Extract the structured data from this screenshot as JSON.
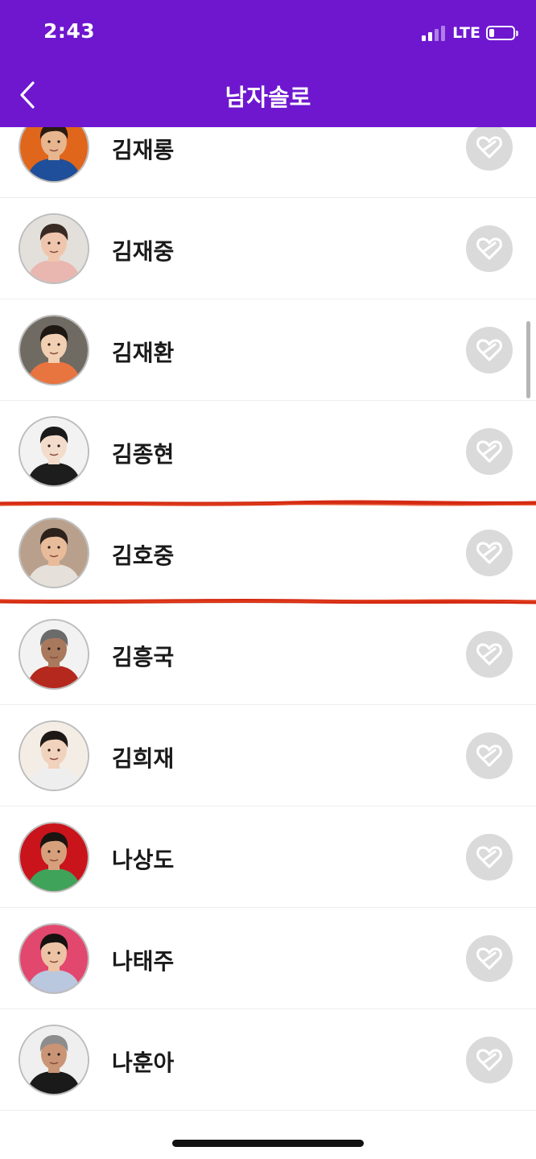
{
  "status_bar": {
    "time": "2:43",
    "network": "LTE",
    "signal_bars": 4,
    "signal_active": 2,
    "battery_level": 0.2
  },
  "nav": {
    "title": "남자솔로",
    "back_icon": "chevron-left-icon"
  },
  "colors": {
    "header_bg": "#6e17cf",
    "highlight_line": "#d42a12",
    "favorite_button_bg": "#dadada"
  },
  "artists": [
    {
      "name": "김재롱",
      "avatar_bg": "#e0661c",
      "skin": "#e7b58e",
      "hair": "#2a1a12",
      "shirt": "#1f4f9a"
    },
    {
      "name": "김재중",
      "avatar_bg": "#e3e0dc",
      "skin": "#efc6ad",
      "hair": "#3a2a24",
      "shirt": "#e9b7b0"
    },
    {
      "name": "김재환",
      "avatar_bg": "#6f6a62",
      "skin": "#f1cfb3",
      "hair": "#1e1712",
      "shirt": "#e8743f"
    },
    {
      "name": "김종현",
      "avatar_bg": "#f2f2f2",
      "skin": "#f3dccb",
      "hair": "#1a1a1a",
      "shirt": "#1d1d1d"
    },
    {
      "name": "김호중",
      "avatar_bg": "#b9a08c",
      "skin": "#e8bb9b",
      "hair": "#2c211b",
      "shirt": "#e6e0da"
    },
    {
      "name": "김흥국",
      "avatar_bg": "#f2f2f2",
      "skin": "#a9795d",
      "hair": "#6b6b6b",
      "shirt": "#b5281e"
    },
    {
      "name": "김희재",
      "avatar_bg": "#f3ede6",
      "skin": "#f1d2bd",
      "hair": "#1e1916",
      "shirt": "#eeeeee"
    },
    {
      "name": "나상도",
      "avatar_bg": "#c9141c",
      "skin": "#d7a07c",
      "hair": "#1b1512",
      "shirt": "#3fa35a"
    },
    {
      "name": "나태주",
      "avatar_bg": "#e2476e",
      "skin": "#ecc3a5",
      "hair": "#161210",
      "shirt": "#b9c7df"
    },
    {
      "name": "나훈아",
      "avatar_bg": "#efefef",
      "skin": "#c99576",
      "hair": "#8d8d8d",
      "shirt": "#1a1a1a"
    }
  ],
  "favorite_icon": "heart-broken-icon",
  "highlighted_artist": "김호중"
}
